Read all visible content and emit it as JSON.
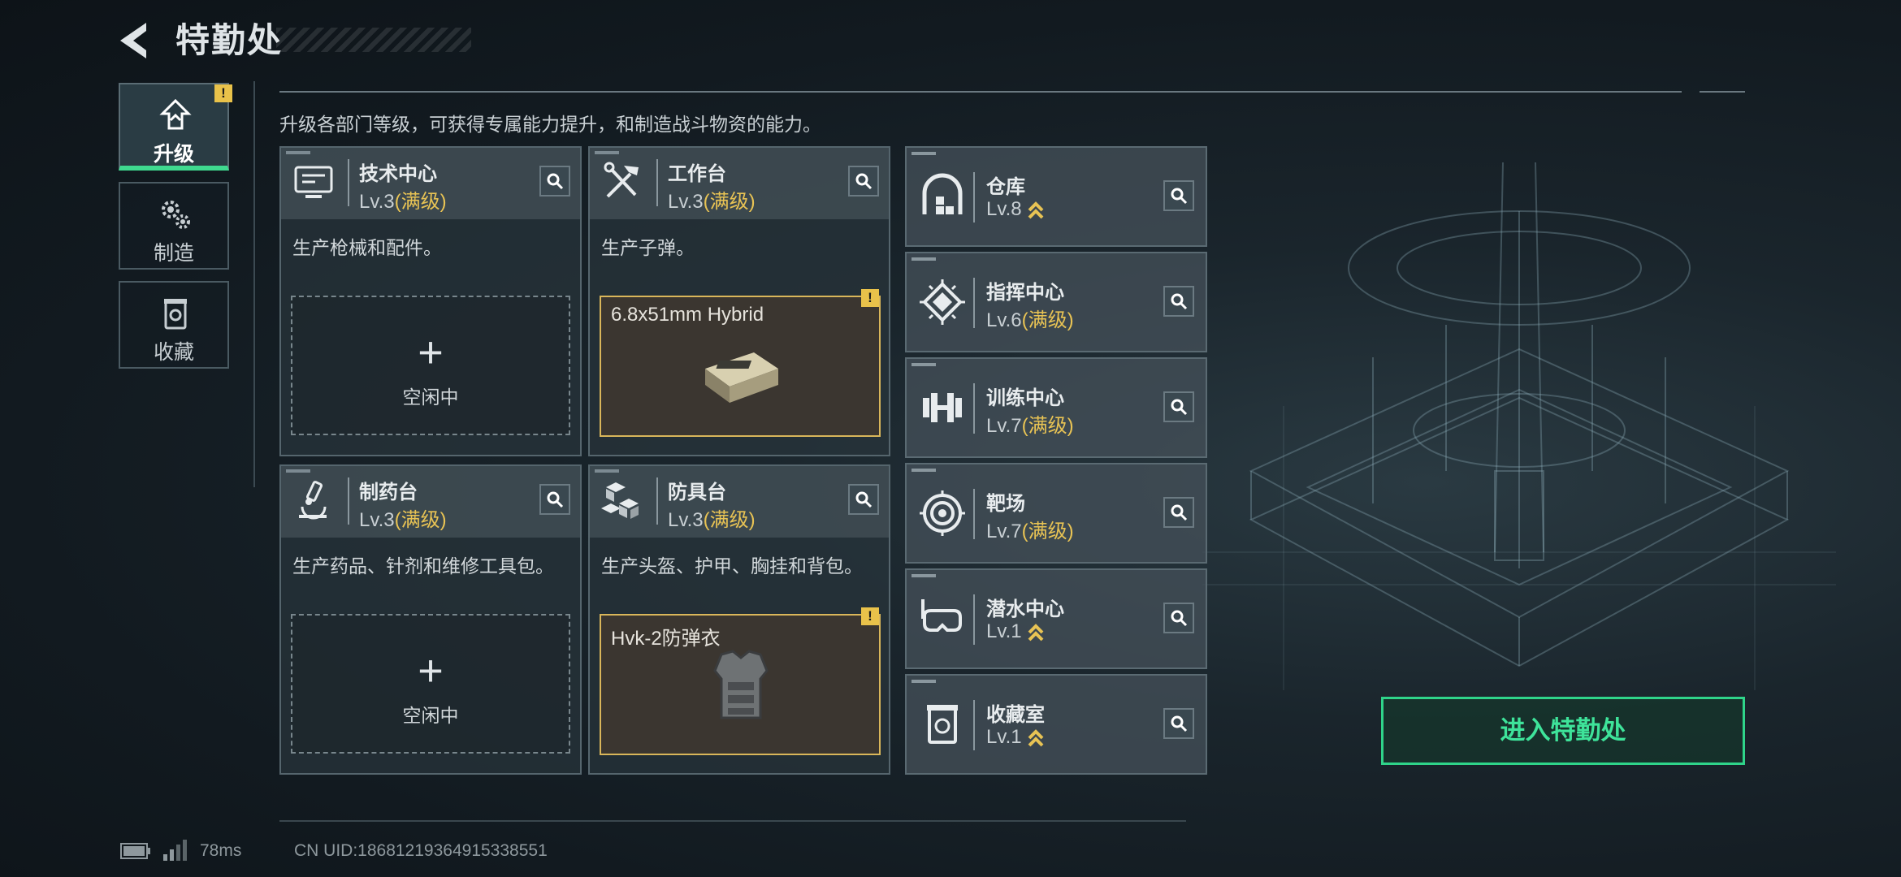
{
  "header": {
    "title": "特勤处"
  },
  "nav": [
    {
      "label": "升级",
      "icon": "upgrade-icon",
      "active": true,
      "badge": "!"
    },
    {
      "label": "制造",
      "icon": "gears-icon",
      "active": false
    },
    {
      "label": "收藏",
      "icon": "collection-icon",
      "active": false
    }
  ],
  "subtitle": "升级各部门等级，可获得专属能力提升，和制造战斗物资的能力。",
  "departments": [
    {
      "name": "技术中心",
      "level": "Lv.3",
      "status": "(满级)",
      "icon": "monitor-icon",
      "desc": "生产枪械和配件。",
      "slot": {
        "state": "empty",
        "plus": "+",
        "label": "空闲中"
      }
    },
    {
      "name": "工作台",
      "level": "Lv.3",
      "status": "(满级)",
      "icon": "tools-icon",
      "desc": "生产子弹。",
      "slot": {
        "state": "item",
        "item": "6.8x51mm Hybrid",
        "badge": "!"
      }
    },
    {
      "name": "制药台",
      "level": "Lv.3",
      "status": "(满级)",
      "icon": "microscope-icon",
      "desc": "生产药品、针剂和维修工具包。",
      "slot": {
        "state": "empty",
        "plus": "+",
        "label": "空闲中"
      }
    },
    {
      "name": "防具台",
      "level": "Lv.3",
      "status": "(满级)",
      "icon": "armor-blocks-icon",
      "desc": "生产头盔、护甲、胸挂和背包。",
      "slot": {
        "state": "item",
        "item": "Hvk-2防弹衣",
        "badge": "!"
      }
    }
  ],
  "facilities": [
    {
      "name": "仓库",
      "level": "Lv.8",
      "status": "",
      "upgradable": true,
      "icon": "warehouse-icon"
    },
    {
      "name": "指挥中心",
      "level": "Lv.6",
      "status": "(满级)",
      "upgradable": false,
      "icon": "command-chip-icon"
    },
    {
      "name": "训练中心",
      "level": "Lv.7",
      "status": "(满级)",
      "upgradable": false,
      "icon": "dumbbell-icon"
    },
    {
      "name": "靶场",
      "level": "Lv.7",
      "status": "(满级)",
      "upgradable": false,
      "icon": "target-icon"
    },
    {
      "name": "潜水中心",
      "level": "Lv.1",
      "status": "",
      "upgradable": true,
      "icon": "diving-mask-icon"
    },
    {
      "name": "收藏室",
      "level": "Lv.1",
      "status": "",
      "upgradable": true,
      "icon": "collection-room-icon"
    }
  ],
  "enter_button": "进入特勤处",
  "status": {
    "ping": "78ms",
    "uid": "CN UID:18681219364915338551"
  },
  "colors": {
    "accent": "#3ee39a",
    "max_level": "#e8c354",
    "warning": "#e9c24a"
  }
}
